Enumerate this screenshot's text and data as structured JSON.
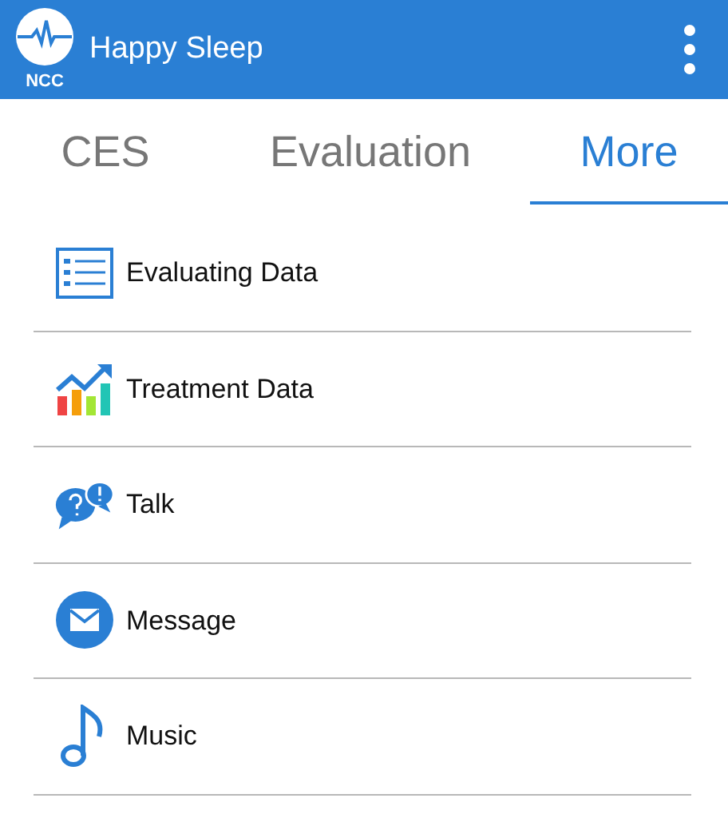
{
  "app_bar": {
    "logo_text": "NCC",
    "title": "Happy Sleep"
  },
  "tabs": [
    {
      "label": "CES",
      "selected": false
    },
    {
      "label": "Evaluation",
      "selected": false
    },
    {
      "label": "More",
      "selected": true
    }
  ],
  "items": [
    {
      "label": "Evaluating Data"
    },
    {
      "label": "Treatment Data"
    },
    {
      "label": "Talk"
    },
    {
      "label": "Message"
    },
    {
      "label": "Music"
    }
  ]
}
